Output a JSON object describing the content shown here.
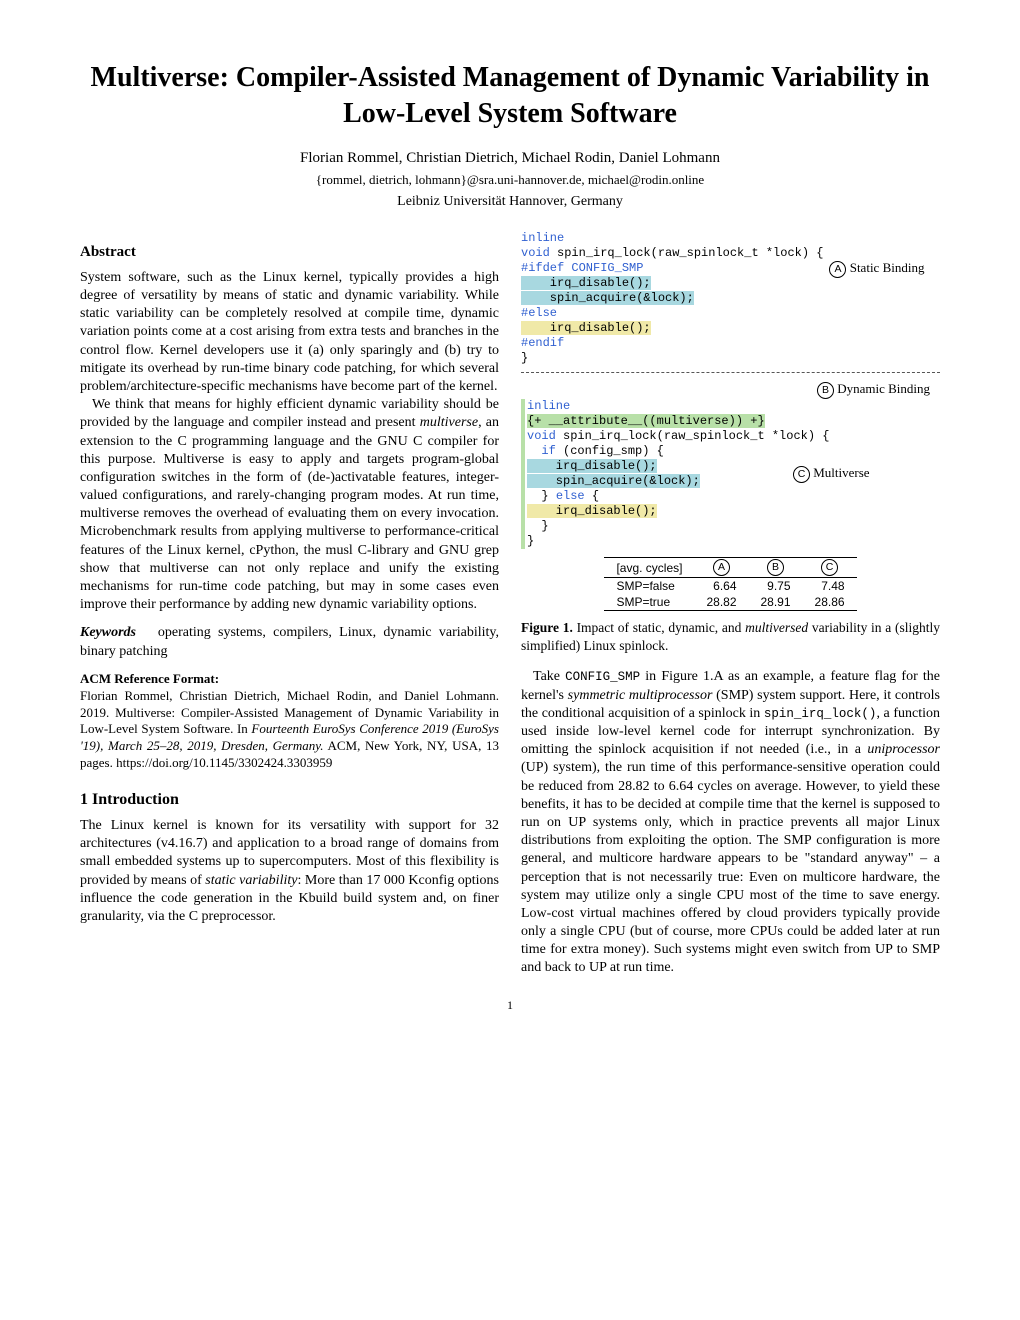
{
  "title": "Multiverse: Compiler-Assisted Management of Dynamic Variability in Low-Level System Software",
  "authors": "Florian Rommel, Christian Dietrich, Michael Rodin, Daniel Lohmann",
  "emails": "{rommel, dietrich, lohmann}@sra.uni-hannover.de, michael@rodin.online",
  "affiliation": "Leibniz Universität Hannover, Germany",
  "abstract_heading": "Abstract",
  "abstract_p1": "System software, such as the Linux kernel, typically provides a high degree of versatility by means of static and dynamic variability. While static variability can be completely resolved at compile time, dynamic variation points come at a cost arising from extra tests and branches in the control flow. Kernel developers use it (a) only sparingly and (b) try to mitigate its overhead by run-time binary code patching, for which several problem/architecture-specific mechanisms have become part of the kernel.",
  "abstract_p2": "We think that means for highly efficient dynamic variability should be provided by the language and compiler instead and present multiverse, an extension to the C programming language and the GNU C compiler for this purpose. Multiverse is easy to apply and targets program-global configuration switches in the form of (de-)activatable features, integer-valued configurations, and rarely-changing program modes. At run time, multiverse removes the overhead of evaluating them on every invocation. Microbenchmark results from applying multiverse to performance-critical features of the Linux kernel, cPython, the musl C-library and GNU grep show that multiverse can not only replace and unify the existing mechanisms for run-time code patching, but may in some cases even improve their performance by adding new dynamic variability options.",
  "keywords_label": "Keywords",
  "keywords_text": "operating systems, compilers, Linux, dynamic variability, binary patching",
  "ref_format_heading": "ACM Reference Format:",
  "ref_text": "Florian Rommel, Christian Dietrich, Michael Rodin, and Daniel Lohmann. 2019. Multiverse: Compiler-Assisted Management of Dynamic Variability in Low-Level System Software. In Fourteenth EuroSys Conference 2019 (EuroSys '19), March 25–28, 2019, Dresden, Germany. ACM, New York, NY, USA, 13 pages. https://doi.org/10.1145/3302424.3303959",
  "intro_heading": "1   Introduction",
  "intro_p1": "The Linux kernel is known for its versatility with support for 32 architectures (v4.16.7) and application to a broad range of domains from small embedded systems up to supercomputers. Most of this flexibility is provided by means of static variability: More than 17 000 Kconfig options influence the code generation in the Kbuild build system and, on finer granularity, via the C preprocessor.",
  "figure": {
    "code_a": {
      "l1": "inline",
      "l2": "void spin_irq_lock(raw_spinlock_t *lock) {",
      "l3": "#ifdef CONFIG_SMP",
      "l4": "    irq_disable();",
      "l5": "    spin_acquire(&lock);",
      "l6": "#else",
      "l7": "    irq_disable();",
      "l8": "#endif",
      "l9": "}"
    },
    "label_a": "Static Binding",
    "label_b": "Dynamic Binding",
    "code_c": {
      "l1": "inline",
      "l2": "{+ __attribute__((multiverse)) +}",
      "l3": "void spin_irq_lock(raw_spinlock_t *lock) {",
      "l4": "  if (config_smp) {",
      "l5": "    irq_disable();",
      "l6": "    spin_acquire(&lock);",
      "l7": "  } else {",
      "l8": "    irq_disable();",
      "l9": "  }",
      "l10": "}"
    },
    "label_c": "Multiverse",
    "table": {
      "header_first": "[avg. cycles]",
      "col_a": "A",
      "col_b": "B",
      "col_c": "C",
      "row1_label": "SMP=false",
      "row1_a": "6.64",
      "row1_b": "9.75",
      "row1_c": "7.48",
      "row2_label": "SMP=true",
      "row2_a": "28.82",
      "row2_b": "28.91",
      "row2_c": "28.86"
    },
    "caption_strong": "Figure 1.",
    "caption_text": "Impact of static, dynamic, and multiversed variability in a (slightly simplified) Linux spinlock."
  },
  "col2_p1_a": "Take ",
  "col2_p1_code": "CONFIG_SMP",
  "col2_p1_b": " in Figure 1.A as an example, a feature flag for the kernel's symmetric multiprocessor (SMP) system support. Here, it controls the conditional acquisition of a spinlock in ",
  "col2_p1_code2": "spin_irq_lock()",
  "col2_p1_c": ", a function used inside low-level kernel code for interrupt synchronization. By omitting the spinlock acquisition if not needed (i.e., in a uniprocessor (UP) system), the run time of this performance-sensitive operation could be reduced from 28.82 to 6.64 cycles on average. However, to yield these benefits, it has to be decided at compile time that the kernel is supposed to run on UP systems only, which in practice prevents all major Linux distributions from exploiting the option. The SMP configuration is more general, and multicore hardware appears to be \"standard anyway\" – a perception that is not necessarily true: Even on multicore hardware, the system may utilize only a single CPU most of the time to save energy. Low-cost virtual machines offered by cloud providers typically provide only a single CPU (but of course, more CPUs could be added later at run time for extra money). Such systems might even switch from UP to SMP and back to UP at run time.",
  "chart_data": {
    "type": "table",
    "title": "Average cycles comparison",
    "categories": [
      "A (Static Binding)",
      "B (Dynamic Binding)",
      "C (Multiverse)"
    ],
    "series": [
      {
        "name": "SMP=false",
        "values": [
          6.64,
          9.75,
          7.48
        ]
      },
      {
        "name": "SMP=true",
        "values": [
          28.82,
          28.91,
          28.86
        ]
      }
    ]
  },
  "page_number": "1"
}
